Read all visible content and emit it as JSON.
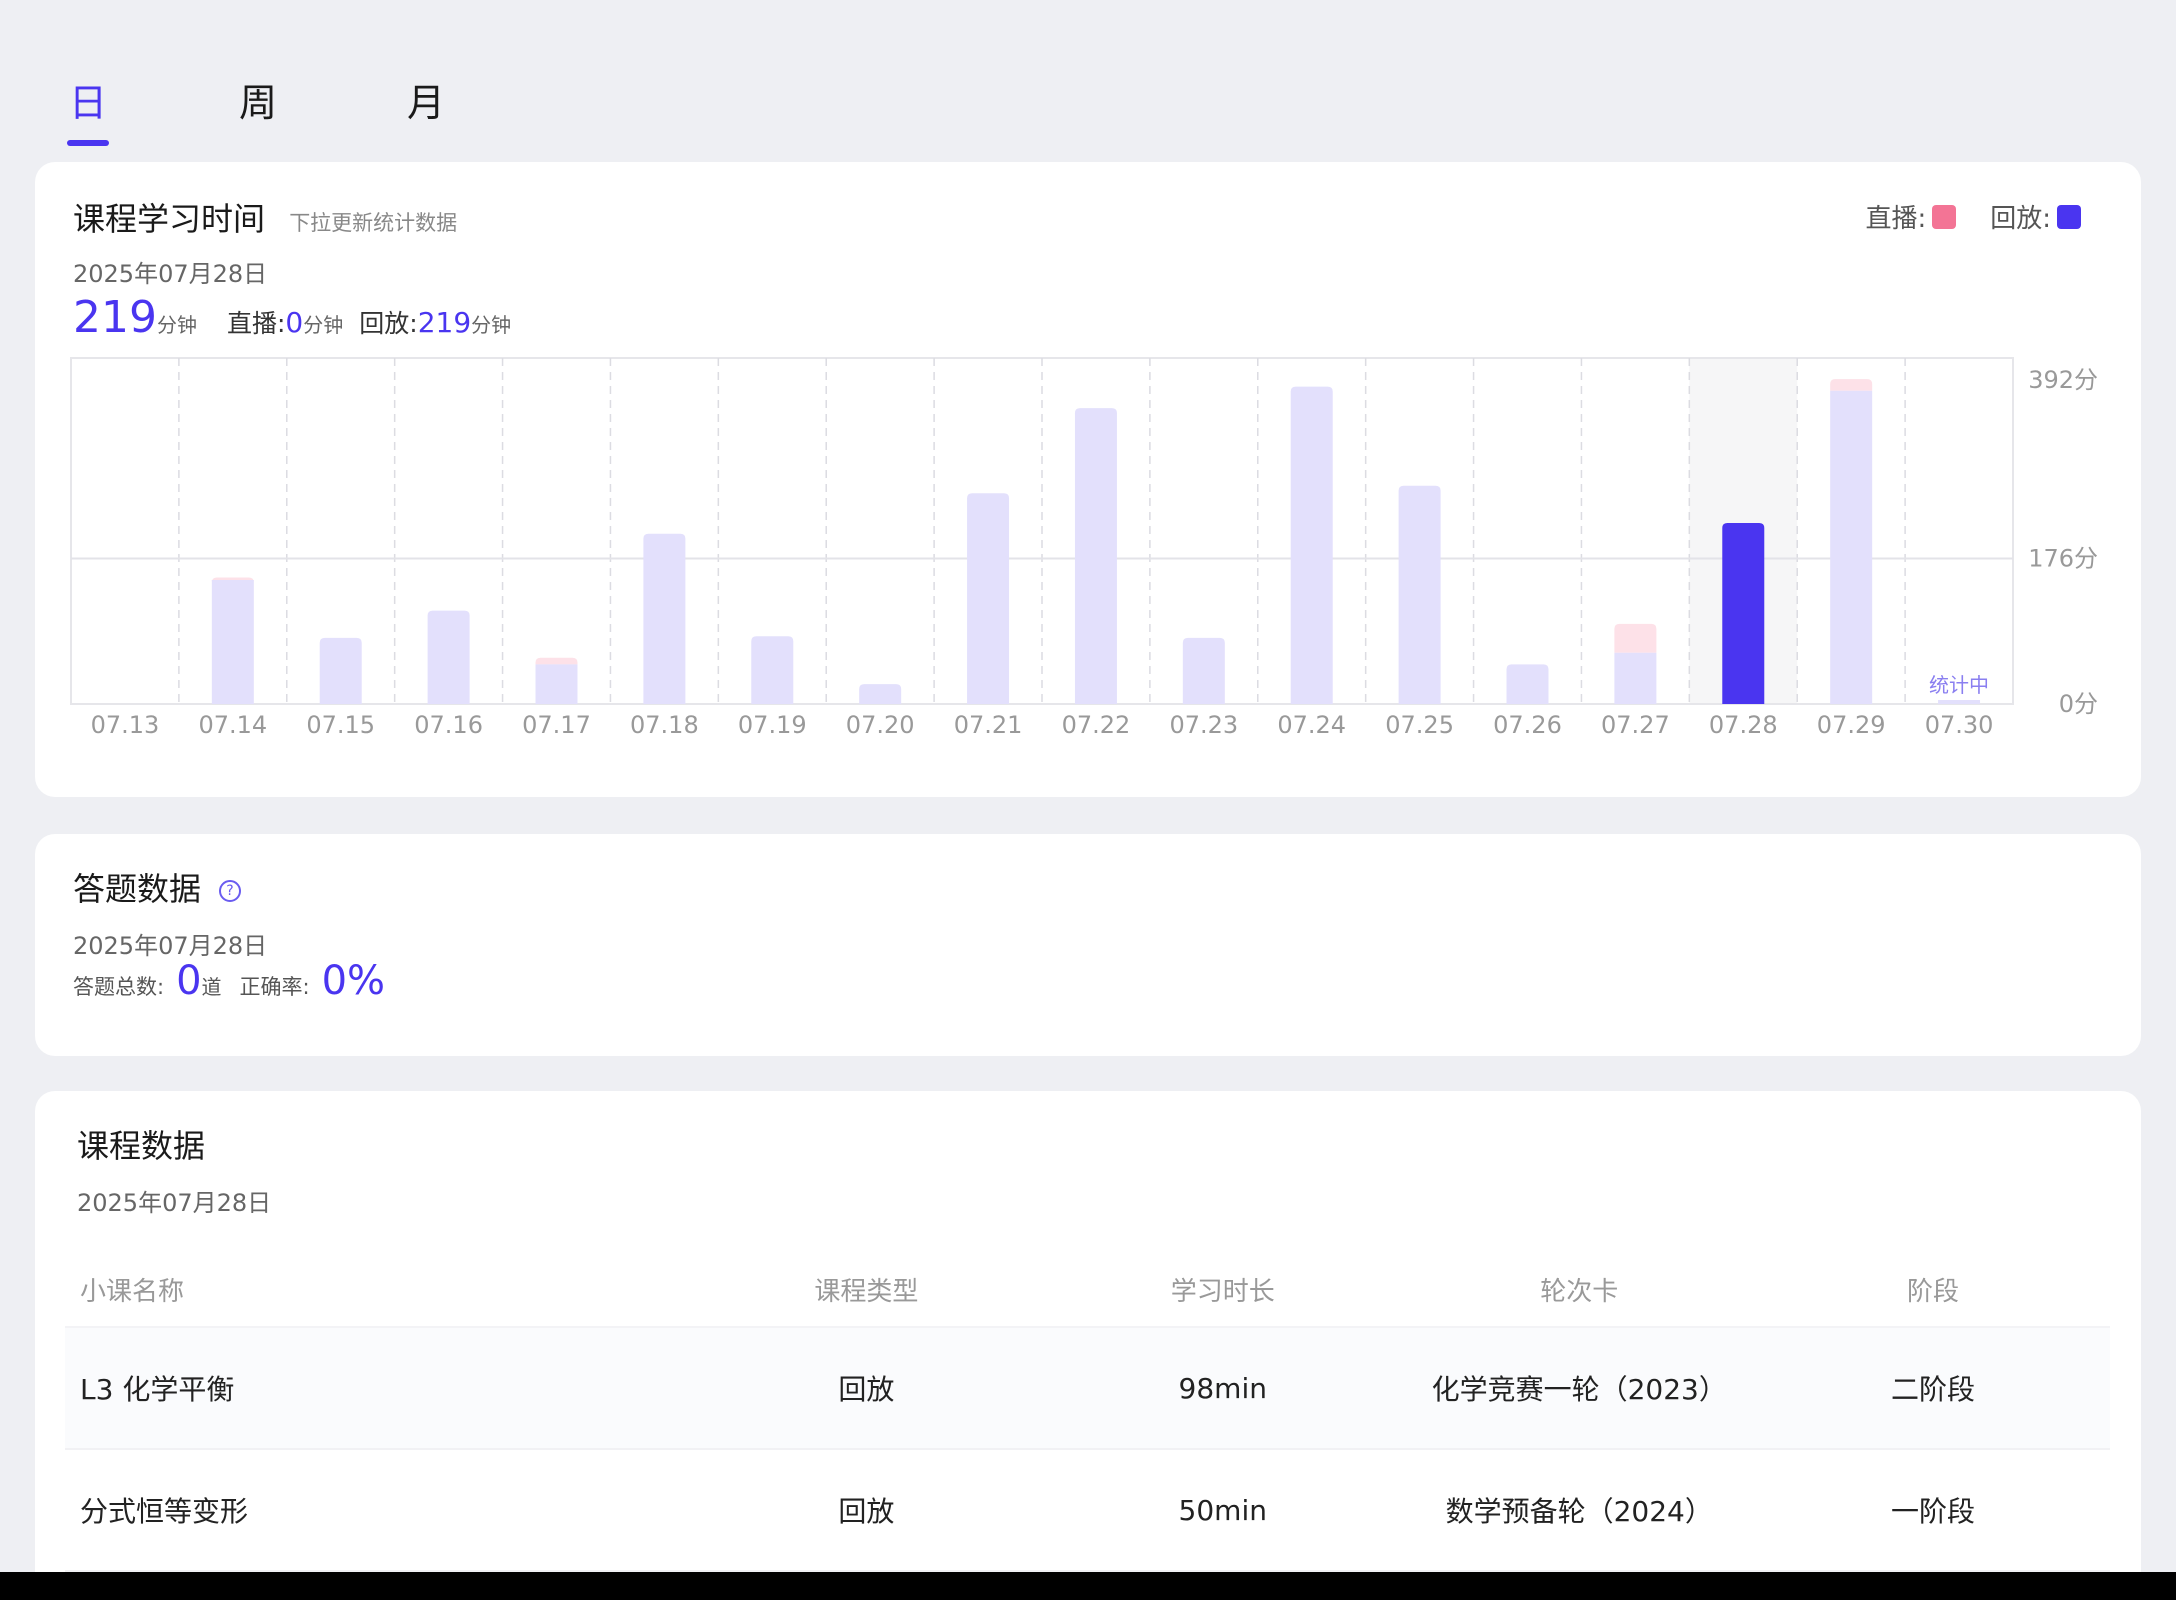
{
  "tabs": [
    {
      "label": "日"
    },
    {
      "label": "周"
    },
    {
      "label": "月"
    }
  ],
  "study_time": {
    "title": "课程学习时间",
    "hint": "下拉更新统计数据",
    "legend_live": "直播:",
    "legend_replay": "回放:",
    "date": "2025年07月28日",
    "total_value": "219",
    "total_unit": "分钟",
    "live_label": "直播:",
    "live_value": "0",
    "live_unit": "分钟",
    "replay_label": "回放:",
    "replay_value": "219",
    "replay_unit": "分钟"
  },
  "colors": {
    "accent": "#4a35f0",
    "live": "#f37495",
    "replay": "#4a35f0",
    "bar_light": "#e3e0fc",
    "bar_live_light": "#fde1e8"
  },
  "chart_data": {
    "type": "bar",
    "categories": [
      "07.13",
      "07.14",
      "07.15",
      "07.16",
      "07.17",
      "07.18",
      "07.19",
      "07.20",
      "07.21",
      "07.22",
      "07.23",
      "07.24",
      "07.25",
      "07.26",
      "07.27",
      "07.28",
      "07.29",
      "07.30"
    ],
    "series": [
      {
        "name": "直播",
        "values": [
          0,
          3,
          0,
          0,
          8,
          0,
          0,
          0,
          0,
          0,
          0,
          0,
          0,
          0,
          35,
          0,
          14,
          0
        ]
      },
      {
        "name": "回放",
        "values": [
          0,
          150,
          80,
          113,
          48,
          206,
          82,
          24,
          255,
          358,
          80,
          384,
          264,
          48,
          62,
          219,
          379,
          0
        ]
      }
    ],
    "selected_index": 15,
    "pending_label": "统计中",
    "pending_index": 17,
    "y_ticks": [
      "392分",
      "176分",
      "0分"
    ],
    "y_tick_values": [
      392,
      176,
      0
    ],
    "ylim": [
      0,
      392
    ],
    "stacked": true,
    "legend_position": "top-right"
  },
  "answers": {
    "title": "答题数据",
    "help": "?",
    "date": "2025年07月28日",
    "total_label": "答题总数:",
    "total_value": "0",
    "total_unit": "道",
    "accuracy_label": "正确率:",
    "accuracy_value": "0%"
  },
  "courses": {
    "title": "课程数据",
    "date": "2025年07月28日",
    "columns": [
      "小课名称",
      "课程类型",
      "学习时长",
      "轮次卡",
      "阶段"
    ],
    "rows": [
      [
        "L3 化学平衡",
        "回放",
        "98min",
        "化学竞赛一轮（2023）",
        "二阶段"
      ],
      [
        "分式恒等变形",
        "回放",
        "50min",
        "数学预备轮（2024）",
        "一阶段"
      ]
    ]
  }
}
